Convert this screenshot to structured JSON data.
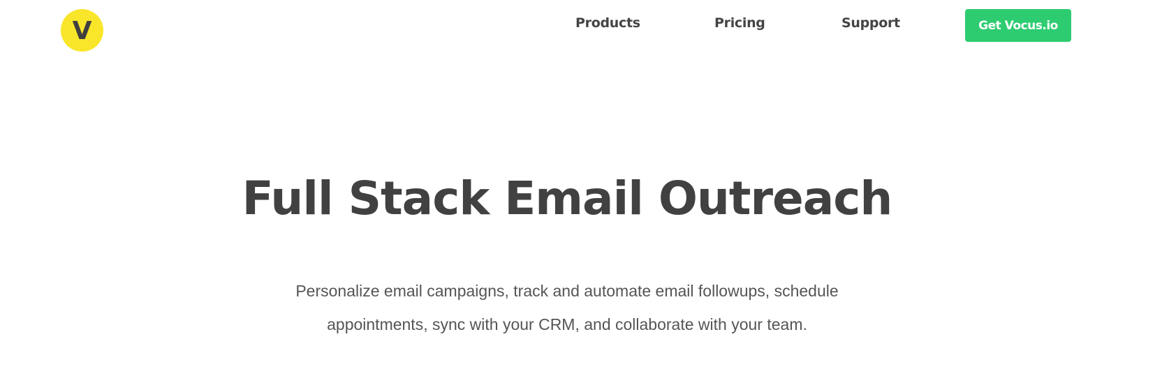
{
  "brand": {
    "logo_letter": "V",
    "logo_color": "#f9e62a"
  },
  "nav": {
    "items": [
      {
        "label": "Products"
      },
      {
        "label": "Pricing"
      },
      {
        "label": "Support"
      }
    ],
    "cta_label": "Get Vocus.io",
    "cta_color": "#2ecc71"
  },
  "hero": {
    "title": "Full Stack Email Outreach",
    "subtitle_line1": "Personalize email campaigns, track and automate email followups, schedule",
    "subtitle_line2": "appointments, sync with your CRM, and collaborate with your team."
  }
}
